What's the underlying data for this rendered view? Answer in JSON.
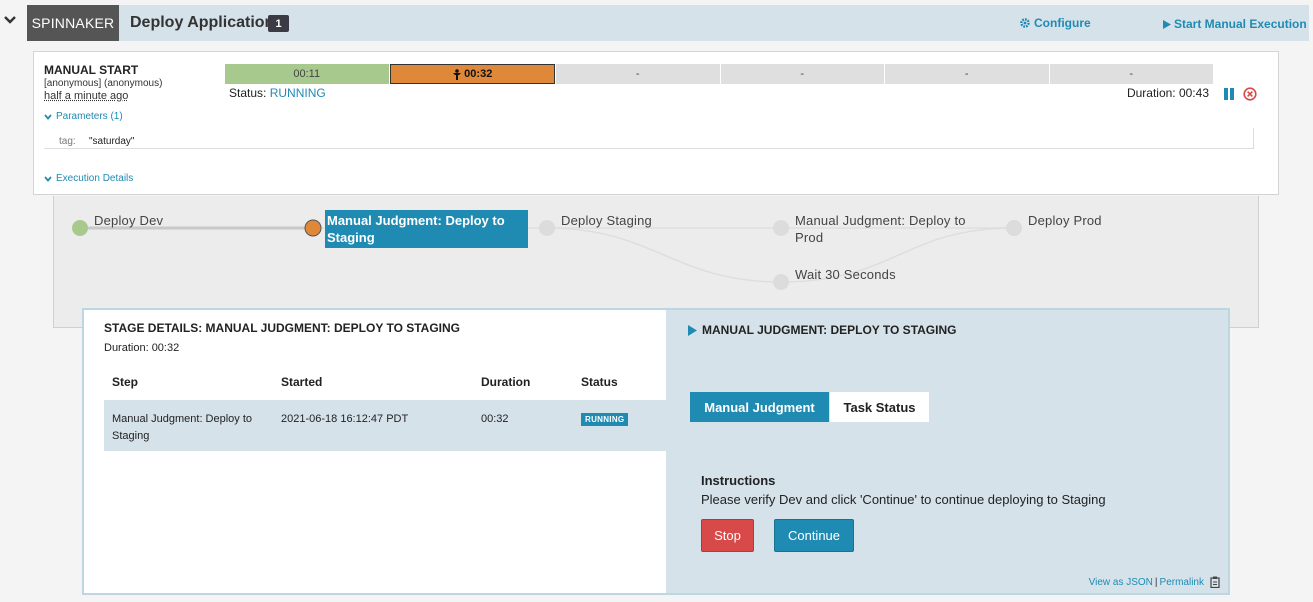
{
  "header": {
    "app_name": "SPINNAKER",
    "pipeline_name": "Deploy Application",
    "execution_count": "1",
    "configure_label": "Configure",
    "start_label": "Start Manual Execution"
  },
  "execution": {
    "trigger_title": "MANUAL START",
    "trigger_user": "[anonymous] (anonymous)",
    "trigger_time": "half a minute ago",
    "stage_bars": [
      "00:11",
      "00:32",
      "-",
      "-",
      "-",
      "-"
    ],
    "status_label": "Status:",
    "status_value": "RUNNING",
    "duration": "Duration: 00:43",
    "params_toggle": "Parameters (1)",
    "param_key": "tag:",
    "param_value": "\"saturday\"",
    "exec_details_toggle": "Execution Details"
  },
  "graph": {
    "nodes": {
      "deploy_dev": "Deploy Dev",
      "mj_staging": "Manual Judgment: Deploy to Staging",
      "deploy_staging": "Deploy Staging",
      "mj_prod": "Manual Judgment: Deploy to Prod",
      "wait": "Wait 30 Seconds",
      "deploy_prod": "Deploy Prod"
    },
    "colors": {
      "succeeded": "#a7c98e",
      "running": "#e0883a",
      "not_started": "#dcdcdc",
      "active": "#1f8bb3"
    }
  },
  "stage_details": {
    "title": "STAGE DETAILS: MANUAL JUDGMENT: DEPLOY TO STAGING",
    "duration": "Duration: 00:32",
    "columns": [
      "Step",
      "Started",
      "Duration",
      "Status"
    ],
    "rows": [
      {
        "step": "Manual Judgment: Deploy to Staging",
        "started": "2021-06-18 16:12:47 PDT",
        "duration": "00:32",
        "status": "RUNNING"
      }
    ]
  },
  "judgment": {
    "title": "MANUAL JUDGMENT: DEPLOY TO STAGING",
    "tabs": [
      "Manual Judgment",
      "Task Status"
    ],
    "instructions_heading": "Instructions",
    "instructions_text": "Please verify Dev and click 'Continue' to continue deploying to Staging",
    "stop_label": "Stop",
    "continue_label": "Continue",
    "view_json": "View as JSON",
    "separator": "|",
    "permalink": "Permalink"
  }
}
